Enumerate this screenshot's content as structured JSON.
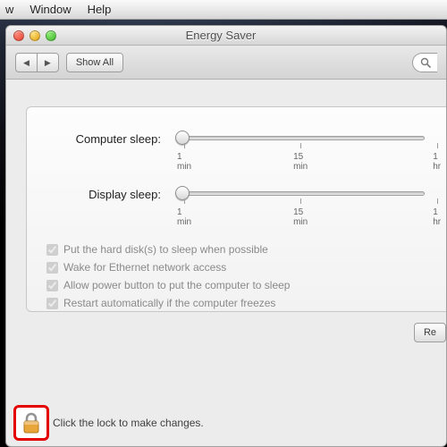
{
  "menubar": {
    "items": [
      "w",
      "Window",
      "Help"
    ]
  },
  "window": {
    "title": "Energy Saver",
    "toolbar": {
      "show_all": "Show All"
    },
    "panel": {
      "computer_sleep_label": "Computer sleep:",
      "display_sleep_label": "Display sleep:",
      "ticks": {
        "t1": "1 min",
        "t2": "15 min",
        "t3": "1 hr"
      },
      "checkboxes": [
        "Put the hard disk(s) to sleep when possible",
        "Wake for Ethernet network access",
        "Allow power button to put the computer to sleep",
        "Restart automatically if the computer freezes"
      ]
    },
    "restore_button": "Re",
    "lock_text": "Click the lock to make changes."
  }
}
